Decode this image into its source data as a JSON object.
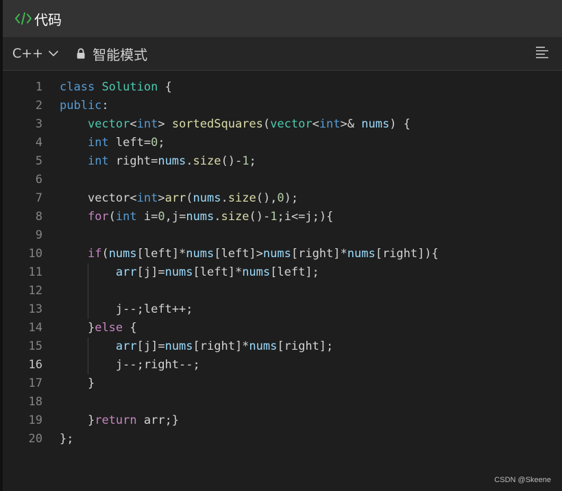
{
  "header": {
    "title": "代码",
    "icon": "code-icon"
  },
  "toolbar": {
    "language": "C++",
    "mode": "智能模式"
  },
  "colors": {
    "keyword": "#569cd6",
    "type": "#4ec9b0",
    "function": "#dcdcaa",
    "variable": "#9cdcfe",
    "number": "#b5cea8",
    "control": "#c586c0",
    "accent": "#3fb950"
  },
  "editor": {
    "active_line": 16,
    "lines": [
      {
        "n": "1",
        "indent": 0,
        "tokens": [
          [
            "kw",
            "class"
          ],
          [
            "pl",
            " "
          ],
          [
            "ty",
            "Solution"
          ],
          [
            "pl",
            " {"
          ]
        ]
      },
      {
        "n": "2",
        "indent": 0,
        "tokens": [
          [
            "kw",
            "public"
          ],
          [
            "pl",
            ":"
          ]
        ]
      },
      {
        "n": "3",
        "indent": 1,
        "tokens": [
          [
            "ty",
            "vector"
          ],
          [
            "pl",
            "<"
          ],
          [
            "kw",
            "int"
          ],
          [
            "pl",
            "> "
          ],
          [
            "fn",
            "sortedSquares"
          ],
          [
            "pl",
            "("
          ],
          [
            "ty",
            "vector"
          ],
          [
            "pl",
            "<"
          ],
          [
            "kw",
            "int"
          ],
          [
            "pl",
            ">& "
          ],
          [
            "va",
            "nums"
          ],
          [
            "pl",
            ") {"
          ]
        ]
      },
      {
        "n": "4",
        "indent": 1,
        "tokens": [
          [
            "kw",
            "int"
          ],
          [
            "pl",
            " left="
          ],
          [
            "nu",
            "0"
          ],
          [
            "pl",
            ";"
          ]
        ]
      },
      {
        "n": "5",
        "indent": 1,
        "tokens": [
          [
            "kw",
            "int"
          ],
          [
            "pl",
            " right="
          ],
          [
            "va",
            "nums"
          ],
          [
            "pl",
            "."
          ],
          [
            "fn",
            "size"
          ],
          [
            "pl",
            "()-"
          ],
          [
            "nu",
            "1"
          ],
          [
            "pl",
            ";"
          ]
        ]
      },
      {
        "n": "6",
        "indent": 0,
        "tokens": []
      },
      {
        "n": "7",
        "indent": 1,
        "tokens": [
          [
            "pl",
            "vector<"
          ],
          [
            "kw",
            "int"
          ],
          [
            "pl",
            ">"
          ],
          [
            "fn",
            "arr"
          ],
          [
            "pl",
            "("
          ],
          [
            "va",
            "nums"
          ],
          [
            "pl",
            "."
          ],
          [
            "fn",
            "size"
          ],
          [
            "pl",
            "(),"
          ],
          [
            "nu",
            "0"
          ],
          [
            "pl",
            ");"
          ]
        ]
      },
      {
        "n": "8",
        "indent": 1,
        "tokens": [
          [
            "ct",
            "for"
          ],
          [
            "pl",
            "("
          ],
          [
            "kw",
            "int"
          ],
          [
            "pl",
            " i="
          ],
          [
            "nu",
            "0"
          ],
          [
            "pl",
            ",j="
          ],
          [
            "va",
            "nums"
          ],
          [
            "pl",
            "."
          ],
          [
            "fn",
            "size"
          ],
          [
            "pl",
            "()-"
          ],
          [
            "nu",
            "1"
          ],
          [
            "pl",
            ";i<=j;){"
          ]
        ]
      },
      {
        "n": "9",
        "indent": 0,
        "tokens": []
      },
      {
        "n": "10",
        "indent": 1,
        "tokens": [
          [
            "ct",
            "if"
          ],
          [
            "pl",
            "("
          ],
          [
            "va",
            "nums"
          ],
          [
            "pl",
            "[left]*"
          ],
          [
            "va",
            "nums"
          ],
          [
            "pl",
            "[left]>"
          ],
          [
            "va",
            "nums"
          ],
          [
            "pl",
            "[right]*"
          ],
          [
            "va",
            "nums"
          ],
          [
            "pl",
            "[right]){"
          ]
        ]
      },
      {
        "n": "11",
        "indent": 2,
        "tokens": [
          [
            "va",
            "arr"
          ],
          [
            "pl",
            "[j]="
          ],
          [
            "va",
            "nums"
          ],
          [
            "pl",
            "[left]*"
          ],
          [
            "va",
            "nums"
          ],
          [
            "pl",
            "[left];"
          ]
        ]
      },
      {
        "n": "12",
        "indent": 2,
        "tokens": []
      },
      {
        "n": "13",
        "indent": 2,
        "tokens": [
          [
            "pl",
            "j--;left++;"
          ]
        ]
      },
      {
        "n": "14",
        "indent": 1,
        "tokens": [
          [
            "pl",
            "}"
          ],
          [
            "ct",
            "else"
          ],
          [
            "pl",
            " {"
          ]
        ]
      },
      {
        "n": "15",
        "indent": 2,
        "tokens": [
          [
            "va",
            "arr"
          ],
          [
            "pl",
            "[j]="
          ],
          [
            "va",
            "nums"
          ],
          [
            "pl",
            "[right]*"
          ],
          [
            "va",
            "nums"
          ],
          [
            "pl",
            "[right];"
          ]
        ]
      },
      {
        "n": "16",
        "indent": 2,
        "tokens": [
          [
            "pl",
            "j--;right--;"
          ]
        ]
      },
      {
        "n": "17",
        "indent": 1,
        "tokens": [
          [
            "pl",
            "}"
          ]
        ]
      },
      {
        "n": "18",
        "indent": 0,
        "tokens": []
      },
      {
        "n": "19",
        "indent": 1,
        "tokens": [
          [
            "pl",
            "}"
          ],
          [
            "ct",
            "return"
          ],
          [
            "pl",
            " arr;}"
          ]
        ]
      },
      {
        "n": "20",
        "indent": 0,
        "tokens": [
          [
            "pl",
            "};"
          ]
        ]
      }
    ]
  },
  "watermark": "CSDN @Skeene"
}
